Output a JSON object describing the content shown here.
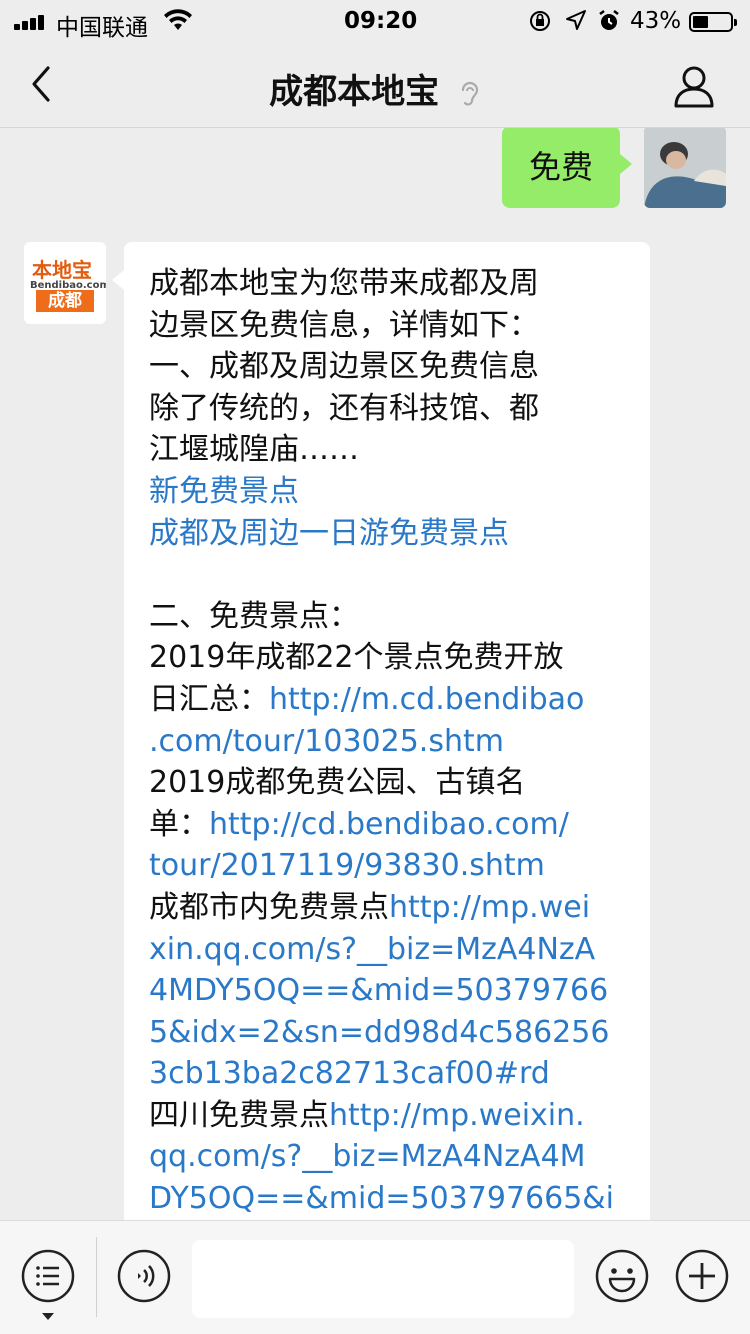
{
  "status_bar": {
    "carrier": "中国联通",
    "time": "09:20",
    "battery_percent": "43%",
    "battery_level": 0.43
  },
  "nav": {
    "title": "成都本地宝",
    "back_icon": "chevron-left-icon",
    "mute_icon": "ear-icon",
    "profile_icon": "person-icon"
  },
  "messages": {
    "sent": {
      "text": "免费"
    },
    "bot_avatar": {
      "brand": "本地宝",
      "domain": "Bendibao.com",
      "city": "成都"
    },
    "reply": {
      "lines": [
        {
          "text": "成都本地宝为您带来成都及周",
          "link": false
        },
        {
          "text": "边景区免费信息，详情如下：",
          "link": false
        },
        {
          "text": "一、成都及周边景区免费信息",
          "link": false
        },
        {
          "text": "除了传统的，还有科技馆、都",
          "link": false
        },
        {
          "text": "江堰城隍庙……",
          "link": false
        },
        {
          "text": "新免费景点",
          "link": true
        },
        {
          "text": "成都及周边一日游免费景点",
          "link": true
        },
        {
          "text": "",
          "link": false
        },
        {
          "text": "二、免费景点：",
          "link": false
        },
        {
          "text": "2019年成都22个景点免费开放",
          "link": false
        },
        {
          "parts": [
            {
              "text": "日汇总：",
              "link": false
            },
            {
              "text": "http://m.cd.bendibao",
              "link": true
            }
          ]
        },
        {
          "text": ".com/tour/103025.shtm",
          "link": true
        },
        {
          "text": "2019成都免费公园、古镇名",
          "link": false
        },
        {
          "parts": [
            {
              "text": "单：",
              "link": false
            },
            {
              "text": "http://cd.bendibao.com/",
              "link": true
            }
          ]
        },
        {
          "text": "tour/2017119/93830.shtm",
          "link": true
        },
        {
          "parts": [
            {
              "text": "成都市内免费景点",
              "link": false
            },
            {
              "text": "http://mp.wei",
              "link": true
            }
          ]
        },
        {
          "text": "xin.qq.com/s?__biz=MzA4NzA",
          "link": true
        },
        {
          "text": "4MDY5OQ==&mid=50379766",
          "link": true
        },
        {
          "text": "5&idx=2&sn=dd98d4c586256",
          "link": true
        },
        {
          "text": "3cb13ba2c82713caf00#rd",
          "link": true
        },
        {
          "parts": [
            {
              "text": "四川免费景点",
              "link": false
            },
            {
              "text": "http://mp.weixin.",
              "link": true
            }
          ]
        },
        {
          "text": "qq.com/s?__biz=MzA4NzA4M",
          "link": true
        },
        {
          "text": "DY5OQ==&mid=503797665&i",
          "link": true
        }
      ]
    }
  },
  "input_bar": {
    "menu_icon": "menu-list-icon",
    "voice_icon": "voice-icon",
    "input_value": "",
    "emoji_icon": "emoji-icon",
    "plus_icon": "plus-icon"
  },
  "colors": {
    "sent_bubble": "#95ec69",
    "link": "#2a78c8",
    "background": "#ededed",
    "brand_orange": "#ef6c1a"
  }
}
